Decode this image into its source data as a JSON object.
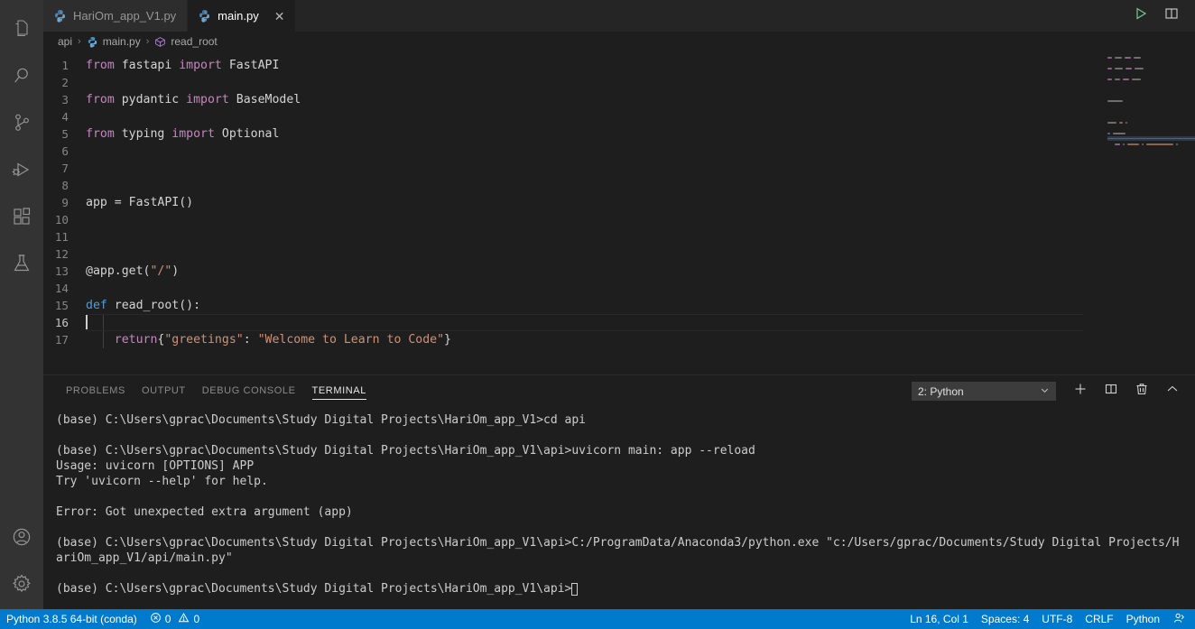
{
  "activitybar": {
    "top_items": [
      {
        "name": "explorer-icon",
        "label": "Explorer"
      },
      {
        "name": "search-icon",
        "label": "Search"
      },
      {
        "name": "source-control-icon",
        "label": "Source Control"
      },
      {
        "name": "run-and-debug-icon",
        "label": "Run and Debug"
      },
      {
        "name": "extensions-icon",
        "label": "Extensions"
      },
      {
        "name": "testing-flask-icon",
        "label": "Testing"
      }
    ],
    "bottom_items": [
      {
        "name": "account-icon",
        "label": "Accounts"
      },
      {
        "name": "gear-icon",
        "label": "Manage"
      }
    ]
  },
  "tabs": [
    {
      "label": "HariOm_app_V1.py",
      "icon": "python-icon",
      "active": false,
      "closable": false
    },
    {
      "label": "main.py",
      "icon": "python-icon",
      "active": true,
      "closable": true,
      "close_glyph": "✕"
    }
  ],
  "editor_actions": [
    {
      "name": "run-python-file-button",
      "label": "Run Python File"
    },
    {
      "name": "split-editor-button",
      "label": "Split Editor"
    }
  ],
  "breadcrumb": {
    "items": [
      "api",
      "main.py",
      "read_root"
    ],
    "separator": "›"
  },
  "code": {
    "lines": [
      {
        "num": "1",
        "tokens": [
          {
            "t": "from",
            "c": "kw"
          },
          {
            "t": " fastapi ",
            "c": "pln"
          },
          {
            "t": "import",
            "c": "kw"
          },
          {
            "t": " FastAPI",
            "c": "pln"
          }
        ]
      },
      {
        "num": "2",
        "tokens": []
      },
      {
        "num": "3",
        "tokens": [
          {
            "t": "from",
            "c": "kw"
          },
          {
            "t": " pydantic ",
            "c": "pln"
          },
          {
            "t": "import",
            "c": "kw"
          },
          {
            "t": " BaseModel",
            "c": "pln"
          }
        ]
      },
      {
        "num": "4",
        "tokens": []
      },
      {
        "num": "5",
        "tokens": [
          {
            "t": "from",
            "c": "kw"
          },
          {
            "t": " typing ",
            "c": "pln"
          },
          {
            "t": "import",
            "c": "kw"
          },
          {
            "t": " Optional",
            "c": "pln"
          }
        ]
      },
      {
        "num": "6",
        "tokens": []
      },
      {
        "num": "7",
        "tokens": []
      },
      {
        "num": "8",
        "tokens": []
      },
      {
        "num": "9",
        "tokens": [
          {
            "t": "app = FastAPI()",
            "c": "pln"
          }
        ]
      },
      {
        "num": "10",
        "tokens": []
      },
      {
        "num": "11",
        "tokens": []
      },
      {
        "num": "12",
        "tokens": []
      },
      {
        "num": "13",
        "tokens": [
          {
            "t": "@app.get(",
            "c": "pln"
          },
          {
            "t": "\"/\"",
            "c": "str"
          },
          {
            "t": ")",
            "c": "pln"
          }
        ]
      },
      {
        "num": "14",
        "tokens": []
      },
      {
        "num": "15",
        "tokens": [
          {
            "t": "def",
            "c": "kw2"
          },
          {
            "t": " read_root():",
            "c": "pln"
          }
        ]
      },
      {
        "num": "16",
        "tokens": [],
        "current": true,
        "cursor": true
      },
      {
        "num": "17",
        "tokens": [
          {
            "t": "    ",
            "c": "pln"
          },
          {
            "t": "return",
            "c": "kw"
          },
          {
            "t": "{",
            "c": "pln"
          },
          {
            "t": "\"greetings\"",
            "c": "str"
          },
          {
            "t": ": ",
            "c": "pln"
          },
          {
            "t": "\"Welcome to Learn to Code\"",
            "c": "str"
          },
          {
            "t": "}",
            "c": "pln"
          }
        ]
      }
    ]
  },
  "panel": {
    "tabs": [
      {
        "label": "PROBLEMS",
        "active": false
      },
      {
        "label": "OUTPUT",
        "active": false
      },
      {
        "label": "DEBUG CONSOLE",
        "active": false
      },
      {
        "label": "TERMINAL",
        "active": true
      }
    ],
    "terminal_selector": {
      "value": "2: Python",
      "chevron": "⌄"
    },
    "actions": [
      {
        "name": "new-terminal-button",
        "label": "New Terminal"
      },
      {
        "name": "split-terminal-button",
        "label": "Split Terminal"
      },
      {
        "name": "kill-terminal-button",
        "label": "Kill Terminal"
      },
      {
        "name": "close-panel-button",
        "label": "Hide Panel"
      }
    ],
    "terminal_lines": [
      "(base) C:\\Users\\gprac\\Documents\\Study Digital Projects\\HariOm_app_V1>cd api",
      "",
      "(base) C:\\Users\\gprac\\Documents\\Study Digital Projects\\HariOm_app_V1\\api>uvicorn main: app --reload",
      "Usage: uvicorn [OPTIONS] APP",
      "Try 'uvicorn --help' for help.",
      "",
      "Error: Got unexpected extra argument (app)",
      "",
      "(base) C:\\Users\\gprac\\Documents\\Study Digital Projects\\HariOm_app_V1\\api>C:/ProgramData/Anaconda3/python.exe \"c:/Users/gprac/Documents/Study Digital Projects/H",
      "ariOm_app_V1/api/main.py\"",
      "",
      "(base) C:\\Users\\gprac\\Documents\\Study Digital Projects\\HariOm_app_V1\\api>"
    ]
  },
  "statusbar": {
    "left": [
      {
        "name": "python-interpreter-status",
        "label": "Python 3.8.5 64-bit (conda)"
      },
      {
        "name": "problems-status",
        "label": "0",
        "label2": "0"
      }
    ],
    "right": [
      {
        "name": "cursor-position-status",
        "label": "Ln 16, Col 1"
      },
      {
        "name": "indentation-status",
        "label": "Spaces: 4"
      },
      {
        "name": "encoding-status",
        "label": "UTF-8"
      },
      {
        "name": "eol-status",
        "label": "CRLF"
      },
      {
        "name": "language-mode-status",
        "label": "Python"
      },
      {
        "name": "feedback-status",
        "label": ""
      }
    ]
  },
  "colors": {
    "accent": "#007acc",
    "editor_bg": "#1e1e1e",
    "tabbar_bg": "#252526",
    "activitybar_bg": "#333333"
  }
}
